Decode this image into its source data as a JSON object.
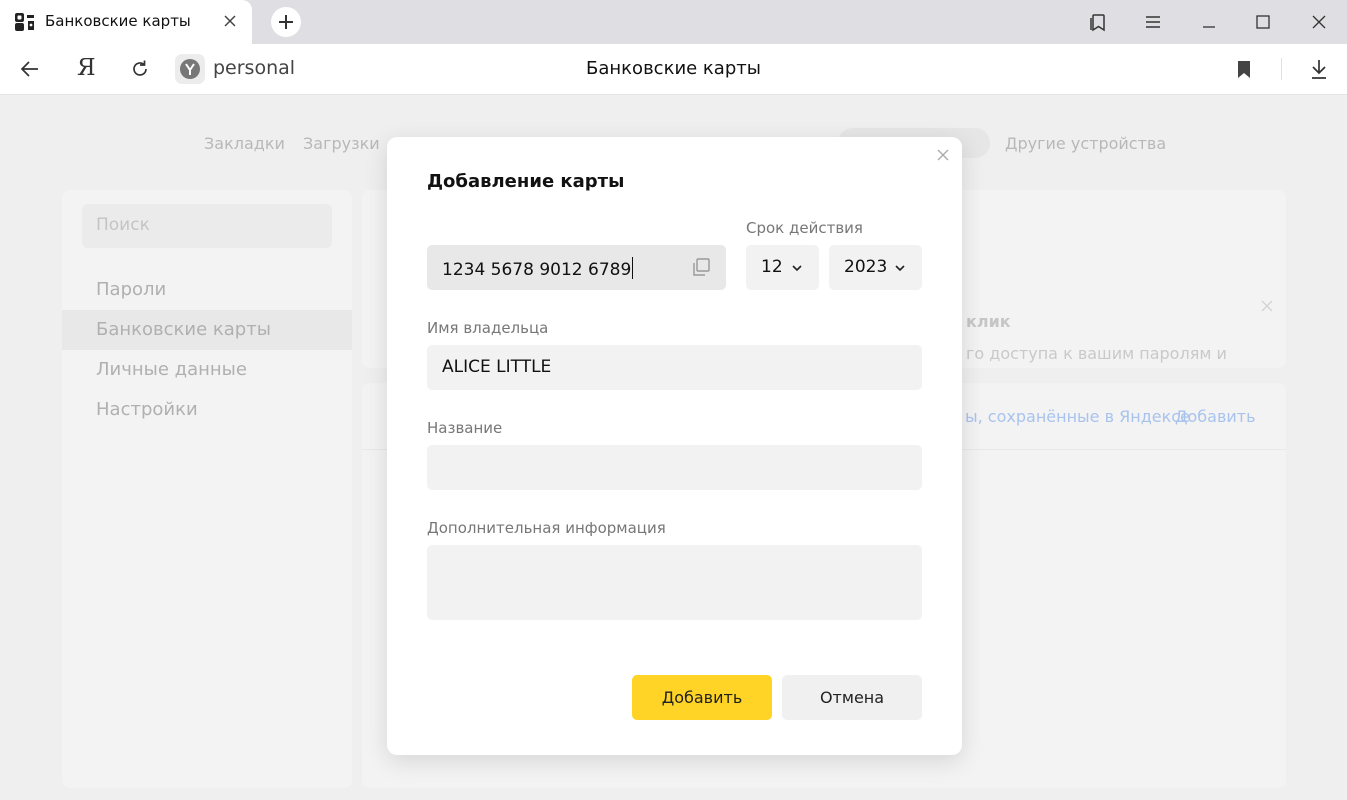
{
  "browser": {
    "tab": {
      "title": "Банковские карты"
    },
    "toolbar": {
      "ya_label": "Я",
      "url": "personal",
      "page_title": "Банковские карты"
    }
  },
  "background": {
    "nav": {
      "bookmarks": "Закладки",
      "downloads": "Загрузки",
      "other_devices": "Другие устройства"
    },
    "sidebar": {
      "search_placeholder": "Поиск",
      "items": [
        {
          "label": "Пароли"
        },
        {
          "label": "Банковские карты",
          "active": true
        },
        {
          "label": "Личные данные"
        },
        {
          "label": "Настройки"
        }
      ]
    },
    "promo": {
      "title_fragment": "клик",
      "text_fragment": "го доступа к вашим паролям и"
    },
    "list": {
      "saved_link_fragment": "ы, сохранённые в Яндексе",
      "add_link": "Добавить"
    }
  },
  "modal": {
    "title": "Добавление карты",
    "card_number": "1234 5678 9012 6789",
    "expiry_label": "Срок действия",
    "expiry_month": "12",
    "expiry_year": "2023",
    "holder_label": "Имя владельца",
    "holder_value": "ALICE LITTLE",
    "name_label": "Название",
    "name_value": "",
    "info_label": "Дополнительная информация",
    "info_value": "",
    "add_button": "Добавить",
    "cancel_button": "Отмена"
  },
  "colors": {
    "primary_button": "#ffd426",
    "link": "#a8c3ee",
    "field_bg": "#f2f2f2"
  }
}
